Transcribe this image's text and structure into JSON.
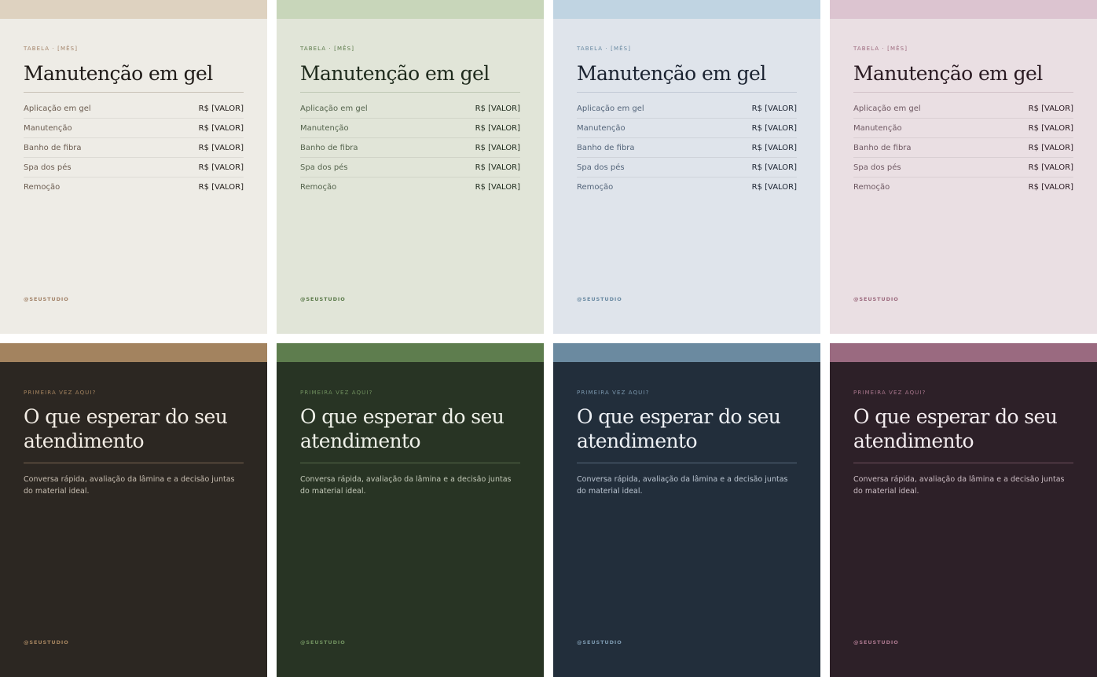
{
  "light_cards": [
    {
      "kicker": "TABELA · [MÊS]",
      "title": "Manutenção em gel",
      "rows": [
        {
          "label": "Aplicação em gel",
          "price": "R$ [VALOR]"
        },
        {
          "label": "Manutenção",
          "price": "R$ [VALOR]"
        },
        {
          "label": "Banho de fibra",
          "price": "R$ [VALOR]"
        },
        {
          "label": "Spa dos pés",
          "price": "R$ [VALOR]"
        },
        {
          "label": "Remoção",
          "price": "R$ [VALOR]"
        }
      ],
      "handle": "@SEUSTUDIO",
      "colors": {
        "band": "#ded2c0",
        "bg": "#eeece6",
        "accent": "#a3846a",
        "text": "#1f1a17",
        "label": "#6b5c50",
        "rule": "#c9c2b8"
      }
    },
    {
      "kicker": "TABELA · [MÊS]",
      "title": "Manutenção em gel",
      "rows": [
        {
          "label": "Aplicação em gel",
          "price": "R$ [VALOR]"
        },
        {
          "label": "Manutenção",
          "price": "R$ [VALOR]"
        },
        {
          "label": "Banho de fibra",
          "price": "R$ [VALOR]"
        },
        {
          "label": "Spa dos pés",
          "price": "R$ [VALOR]"
        },
        {
          "label": "Remoção",
          "price": "R$ [VALOR]"
        }
      ],
      "handle": "@SEUSTUDIO",
      "colors": {
        "band": "#c8d6ba",
        "bg": "#e1e5d8",
        "accent": "#5b7a4a",
        "text": "#1e2a1c",
        "label": "#54634c",
        "rule": "#c0c9b6"
      }
    },
    {
      "kicker": "TABELA · [MÊS]",
      "title": "Manutenção em gel",
      "rows": [
        {
          "label": "Aplicação em gel",
          "price": "R$ [VALOR]"
        },
        {
          "label": "Manutenção",
          "price": "R$ [VALOR]"
        },
        {
          "label": "Banho de fibra",
          "price": "R$ [VALOR]"
        },
        {
          "label": "Spa dos pés",
          "price": "R$ [VALOR]"
        },
        {
          "label": "Remoção",
          "price": "R$ [VALOR]"
        }
      ],
      "handle": "@SEUSTUDIO",
      "colors": {
        "band": "#c0d4e2",
        "bg": "#dfe4eb",
        "accent": "#6a8aa2",
        "text": "#1a2230",
        "label": "#54657a",
        "rule": "#c2cad6"
      }
    },
    {
      "kicker": "TABELA · [MÊS]",
      "title": "Manutenção em gel",
      "rows": [
        {
          "label": "Aplicação em gel",
          "price": "R$ [VALOR]"
        },
        {
          "label": "Manutenção",
          "price": "R$ [VALOR]"
        },
        {
          "label": "Banho de fibra",
          "price": "R$ [VALOR]"
        },
        {
          "label": "Spa dos pés",
          "price": "R$ [VALOR]"
        },
        {
          "label": "Remoção",
          "price": "R$ [VALOR]"
        }
      ],
      "handle": "@SEUSTUDIO",
      "colors": {
        "band": "#dcc4d0",
        "bg": "#eadfe3",
        "accent": "#9c6a7e",
        "text": "#2a1a22",
        "label": "#6e5862",
        "rule": "#d2c2c9"
      }
    }
  ],
  "dark_cards": [
    {
      "kicker": "PRIMEIRA VEZ AQUI?",
      "title": "O que esperar do seu atendimento",
      "description": "Conversa rápida, avaliação da lâmina e a decisão juntas do material ideal.",
      "handle": "@SEUSTUDIO",
      "colors": {
        "band": "#a3835f",
        "bg": "#2c2722",
        "accent": "#a3835f",
        "text": "#f2ece4",
        "body": "#c9bfb2",
        "rule": "#7a6550"
      }
    },
    {
      "kicker": "PRIMEIRA VEZ AQUI?",
      "title": "O que esperar do seu atendimento",
      "description": "Conversa rápida, avaliação da lâmina e a decisão juntas do material ideal.",
      "handle": "@SEUSTUDIO",
      "colors": {
        "band": "#5e7d4e",
        "bg": "#283424",
        "accent": "#6f8f5e",
        "text": "#eef0e8",
        "body": "#c3c9b8",
        "rule": "#55674a"
      }
    },
    {
      "kicker": "PRIMEIRA VEZ AQUI?",
      "title": "O que esperar do seu atendimento",
      "description": "Conversa rápida, avaliação da lâmina e a decisão juntas do material ideal.",
      "handle": "@SEUSTUDIO",
      "colors": {
        "band": "#6b8aa0",
        "bg": "#222e3b",
        "accent": "#7b97ad",
        "text": "#eef1f5",
        "body": "#bcc6d2",
        "rule": "#55687a"
      }
    },
    {
      "kicker": "PRIMEIRA VEZ AQUI?",
      "title": "O que esperar do seu atendimento",
      "description": "Conversa rápida, avaliação da lâmina e a decisão juntas do material ideal.",
      "handle": "@SEUSTUDIO",
      "colors": {
        "band": "#9a6a80",
        "bg": "#2d2028",
        "accent": "#a8768c",
        "text": "#f3ecef",
        "body": "#cdbec5",
        "rule": "#6e4f5d"
      }
    }
  ]
}
